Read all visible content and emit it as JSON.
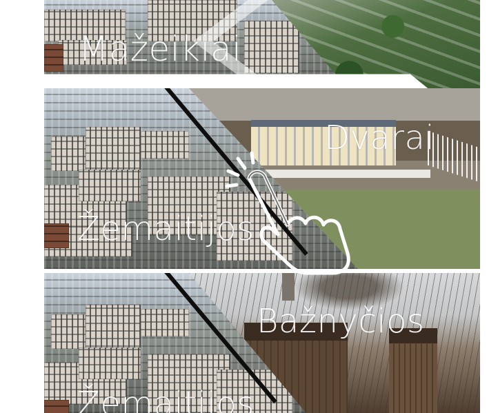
{
  "cards": [
    {
      "from_label": "Mažeikiai",
      "to_label": ""
    },
    {
      "from_label": "Žemaitijos",
      "to_label": "Dvarai"
    },
    {
      "from_label": "Žemaitijos",
      "to_label": "Bažnyčios"
    }
  ],
  "icons": {
    "tap_icon": "hand-tap-icon"
  },
  "colors": {
    "divider": "#0e0e0e",
    "label_text": "#ffffff",
    "background": "#ffffff"
  }
}
